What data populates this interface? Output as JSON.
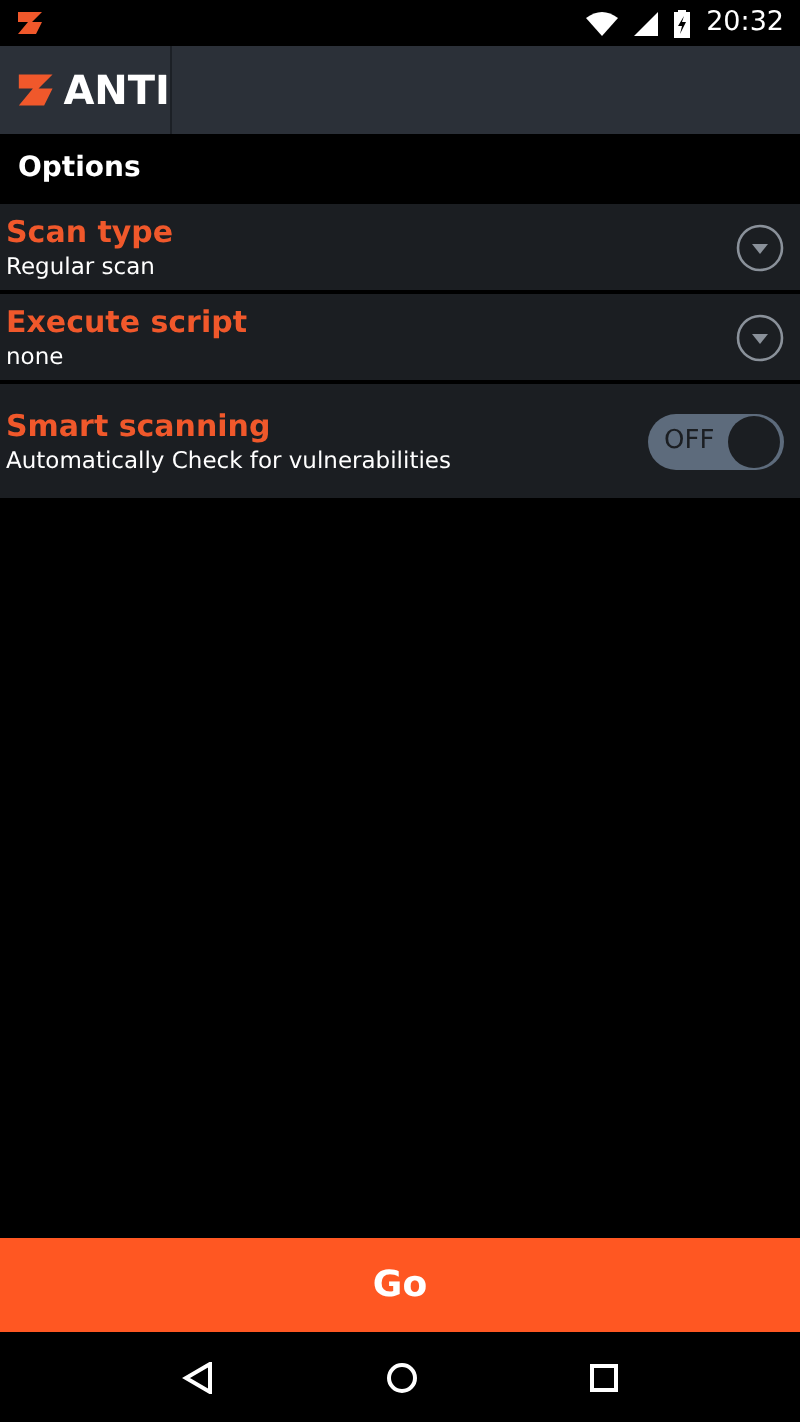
{
  "status_bar": {
    "time": "20:32"
  },
  "app_bar": {
    "title": "ANTI"
  },
  "section": {
    "title": "Options"
  },
  "options": [
    {
      "kind": "dropdown",
      "title": "Scan type",
      "value": "Regular scan"
    },
    {
      "kind": "dropdown",
      "title": "Execute script",
      "value": "none"
    },
    {
      "kind": "toggle",
      "title": "Smart scanning",
      "value": "Automatically Check for vulnerabilities",
      "on": false,
      "switch_label": "OFF"
    }
  ],
  "go_button": {
    "label": "Go"
  }
}
